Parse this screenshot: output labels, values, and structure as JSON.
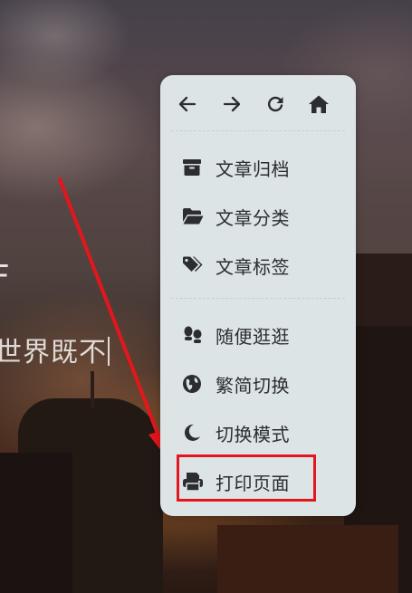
{
  "background": {
    "partial_text": "世界既不",
    "partial_glyph": "F",
    "accent_colors": {
      "menu_bg": "#dde4e6",
      "annotation_red": "#e4161c",
      "text_dark": "#2b2d31"
    }
  },
  "menu": {
    "nav_buttons": [
      {
        "name": "back",
        "icon": "arrow-left-icon"
      },
      {
        "name": "forward",
        "icon": "arrow-right-icon"
      },
      {
        "name": "refresh",
        "icon": "refresh-icon"
      },
      {
        "name": "home",
        "icon": "home-icon"
      }
    ],
    "groups": [
      {
        "items": [
          {
            "label": "文章归档",
            "icon": "archive-box-icon"
          },
          {
            "label": "文章分类",
            "icon": "folder-open-icon"
          },
          {
            "label": "文章标签",
            "icon": "tags-icon"
          }
        ]
      },
      {
        "items": [
          {
            "label": "随便逛逛",
            "icon": "footprints-icon"
          },
          {
            "label": "繁简切换",
            "icon": "globe-icon"
          },
          {
            "label": "切换模式",
            "icon": "moon-icon"
          },
          {
            "label": "打印页面",
            "icon": "print-icon"
          }
        ]
      }
    ],
    "highlighted_item": "打印页面"
  }
}
